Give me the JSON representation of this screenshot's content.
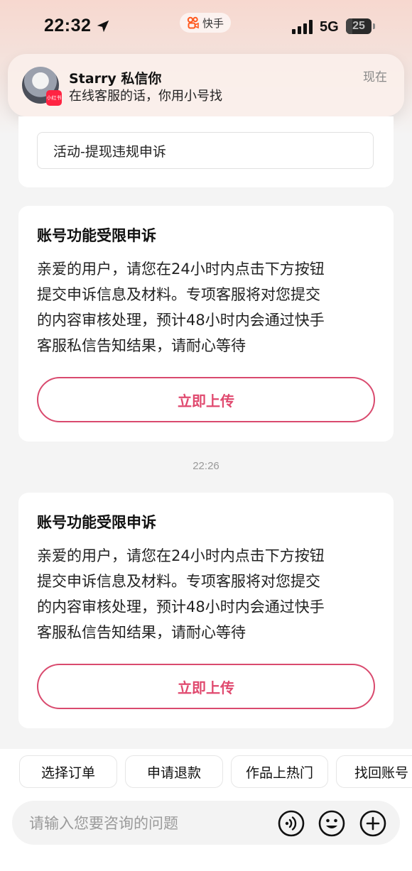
{
  "status_bar": {
    "time": "22:32",
    "app_pill_label": "快手",
    "network": "5G",
    "battery": "25",
    "battery_level": 0.25
  },
  "notification": {
    "title": "Starry 私信你",
    "message": "在线客服的话，你用小号找",
    "when": "现在",
    "app_badge": "小红书"
  },
  "previous_card": {
    "reason": "活动-提现违规申诉"
  },
  "cards": [
    {
      "title": "账号功能受限申诉",
      "body_lines": [
        "亲爱的用户，请您在24小时内点击下方按钮",
        "提交申诉信息及材料。专项客服将对您提交",
        "的内容审核处理，预计48小时内会通过快手",
        "客服私信告知结果，请耐心等待"
      ],
      "button_label": "立即上传"
    },
    {
      "title": "账号功能受限申诉",
      "body_lines": [
        "亲爱的用户，请您在24小时内点击下方按钮",
        "提交申诉信息及材料。专项客服将对您提交",
        "的内容审核处理，预计48小时内会通过快手",
        "客服私信告知结果，请耐心等待"
      ],
      "button_label": "立即上传"
    }
  ],
  "timestamp": "22:26",
  "quick_chips": [
    "选择订单",
    "申请退款",
    "作品上热门",
    "找回账号"
  ],
  "input": {
    "placeholder": "请输入您要咨询的问题",
    "value": ""
  },
  "icons": {
    "voice": "voice-icon",
    "emoji": "emoji-icon",
    "add": "plus-circle-icon"
  },
  "colors": {
    "accent": "#e04a6f",
    "background": "#f4f4f4"
  }
}
